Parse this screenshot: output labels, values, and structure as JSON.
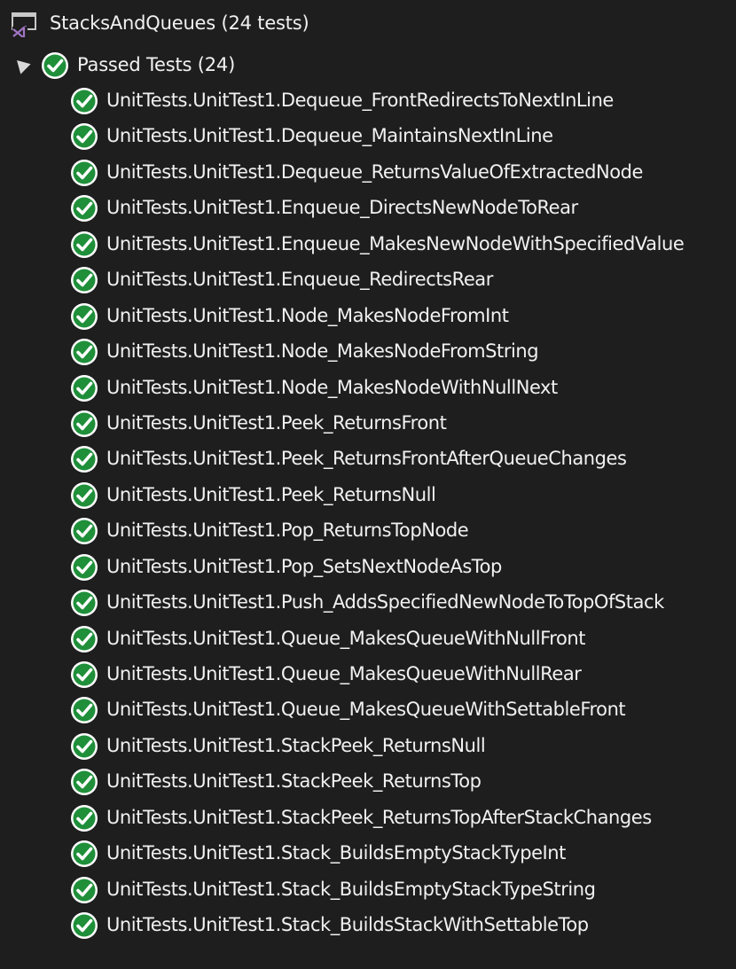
{
  "colors": {
    "background": "#1e1e1e",
    "text": "#f1f1f1",
    "pass_green": "#1f8f3a",
    "vs_purple": "#a074c4"
  },
  "project": {
    "title": "StacksAndQueues (24 tests)",
    "icon": "visual-studio-project-icon"
  },
  "group": {
    "label": "Passed Tests (24)",
    "expanded": true,
    "icon": "passed-check-icon"
  },
  "tests": [
    "UnitTests.UnitTest1.Dequeue_FrontRedirectsToNextInLine",
    "UnitTests.UnitTest1.Dequeue_MaintainsNextInLine",
    "UnitTests.UnitTest1.Dequeue_ReturnsValueOfExtractedNode",
    "UnitTests.UnitTest1.Enqueue_DirectsNewNodeToRear",
    "UnitTests.UnitTest1.Enqueue_MakesNewNodeWithSpecifiedValue",
    "UnitTests.UnitTest1.Enqueue_RedirectsRear",
    "UnitTests.UnitTest1.Node_MakesNodeFromInt",
    "UnitTests.UnitTest1.Node_MakesNodeFromString",
    "UnitTests.UnitTest1.Node_MakesNodeWithNullNext",
    "UnitTests.UnitTest1.Peek_ReturnsFront",
    "UnitTests.UnitTest1.Peek_ReturnsFrontAfterQueueChanges",
    "UnitTests.UnitTest1.Peek_ReturnsNull",
    "UnitTests.UnitTest1.Pop_ReturnsTopNode",
    "UnitTests.UnitTest1.Pop_SetsNextNodeAsTop",
    "UnitTests.UnitTest1.Push_AddsSpecifiedNewNodeToTopOfStack",
    "UnitTests.UnitTest1.Queue_MakesQueueWithNullFront",
    "UnitTests.UnitTest1.Queue_MakesQueueWithNullRear",
    "UnitTests.UnitTest1.Queue_MakesQueueWithSettableFront",
    "UnitTests.UnitTest1.StackPeek_ReturnsNull",
    "UnitTests.UnitTest1.StackPeek_ReturnsTop",
    "UnitTests.UnitTest1.StackPeek_ReturnsTopAfterStackChanges",
    "UnitTests.UnitTest1.Stack_BuildsEmptyStackTypeInt",
    "UnitTests.UnitTest1.Stack_BuildsEmptyStackTypeString",
    "UnitTests.UnitTest1.Stack_BuildsStackWithSettableTop"
  ]
}
